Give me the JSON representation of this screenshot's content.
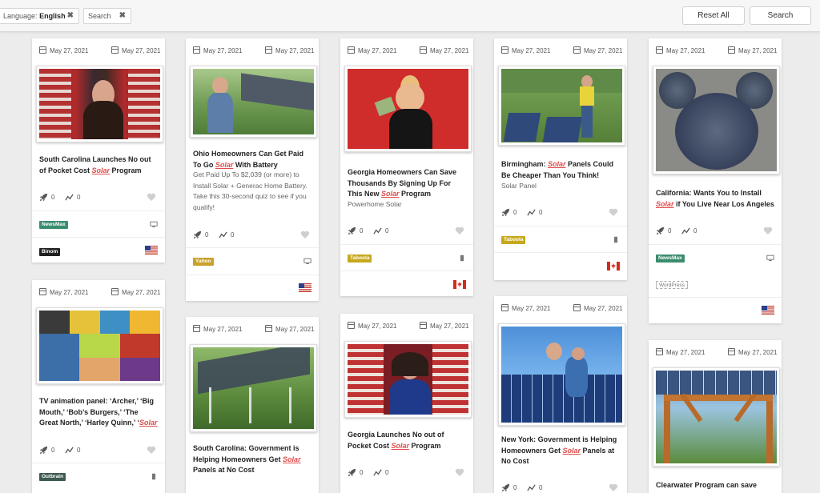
{
  "filters": {
    "language_label": "Language:",
    "language_value": "English",
    "search_chip": "Search",
    "reset_label": "Reset All",
    "search_label": "Search"
  },
  "date": "May 27, 2021",
  "cards": {
    "c1": {
      "title_pre": "South Carolina Launches No out of Pocket Cost ",
      "title_kw": "Solar",
      "title_post": " Program",
      "stat1": "0",
      "stat2": "0",
      "tag": "NewsMax",
      "tag2": "Binom"
    },
    "c2": {
      "title_pre": "Ohio Homeowners Can Get Paid To Go ",
      "title_kw": "Solar",
      "title_post": " With Battery",
      "desc": "Get Paid Up To $2,039 (or more) to Install Solar + Generac Home Battery. Take this 30-second quiz to see if you qualify!",
      "stat1": "0",
      "stat2": "0",
      "tag": "Yahoo"
    },
    "c3": {
      "title_pre": "Georgia Homeowners Can Save Thousands By Signing Up For This New ",
      "title_kw": "Solar",
      "title_post": " Program",
      "desc": "Powerhome Solar",
      "stat1": "0",
      "stat2": "0",
      "tag": "Taboola"
    },
    "c4": {
      "title_pre": "Birmingham: ",
      "title_kw": "Solar",
      "title_post": " Panels Could Be Cheaper Than You Think!",
      "desc": "Solar Panel",
      "stat1": "0",
      "stat2": "0",
      "tag": "Taboola"
    },
    "c5": {
      "title_pre": "California: Wants You to Install ",
      "title_kw": "Solar",
      "title_post": " if You Live Near Los Angeles",
      "stat1": "0",
      "stat2": "0",
      "tag": "NewsMax",
      "tag2": "WordPress"
    },
    "c6": {
      "title_pre": "TV animation panel: ‘Archer,’ ‘Big Mouth,’ ‘Bob’s Burgers,’ ‘The Great North,’ ‘Harley Quinn,’ ‘",
      "title_kw": "Solar",
      "title_post": "",
      "stat1": "0",
      "stat2": "0",
      "tag": "Outbrain"
    },
    "c7": {
      "title_pre": "South Carolina: Government is Helping Homeowners Get ",
      "title_kw": "Solar",
      "title_post": " Panels at No Cost"
    },
    "c8": {
      "title_pre": "Georgia Launches No out of Pocket Cost ",
      "title_kw": "Solar",
      "title_post": " Program",
      "stat1": "0",
      "stat2": "0"
    },
    "c9": {
      "title_pre": "New York: Government is Helping Homeowners Get ",
      "title_kw": "Solar",
      "title_post": " Panels at No Cost",
      "stat1": "0",
      "stat2": "0"
    },
    "c10": {
      "title_pre": "Clearwater Program can save",
      "title_kw": "",
      "title_post": ""
    }
  },
  "colors": {
    "accent": "#e04b4b",
    "newsmax": "#3a8c6e",
    "taboola": "#c6a81d",
    "yahoo": "#c8a22a",
    "outbrain": "#3e5b50"
  },
  "icons": [
    "calendar-icon",
    "rocket-icon",
    "trend-icon",
    "heart-icon",
    "desktop-icon",
    "mobile-icon",
    "us-flag-icon",
    "ca-flag-icon",
    "close-icon"
  ]
}
